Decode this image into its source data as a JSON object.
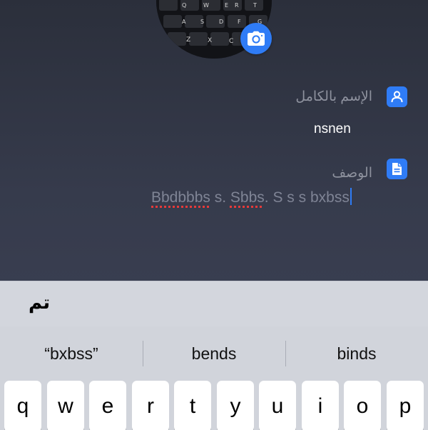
{
  "profile": {
    "camera_icon": "camera-icon",
    "avatar_keys": [
      "Q",
      "W",
      "E",
      "R",
      "T",
      "A",
      "S",
      "D",
      "F",
      "G",
      "Z",
      "X",
      "C"
    ]
  },
  "fields": {
    "full_name": {
      "label": "الإسم بالكامل",
      "value": "nsnen",
      "icon": "person-icon"
    },
    "description": {
      "label": "الوصف",
      "parts": [
        "Bbdbbbs",
        " s. ",
        "Sbbs",
        ". S s s bxbss"
      ],
      "icon": "document-icon"
    }
  },
  "toolbar": {
    "done_label": "تم"
  },
  "keyboard": {
    "suggestions": [
      "“bxbss”",
      "bends",
      "binds"
    ],
    "keys": [
      "q",
      "w",
      "e",
      "r",
      "t",
      "y",
      "u",
      "i",
      "o",
      "p"
    ]
  },
  "colors": {
    "accent": "#2f7cf6",
    "background": "#363b4c",
    "label": "#8e929e",
    "keyboard": "#d1d4db"
  }
}
